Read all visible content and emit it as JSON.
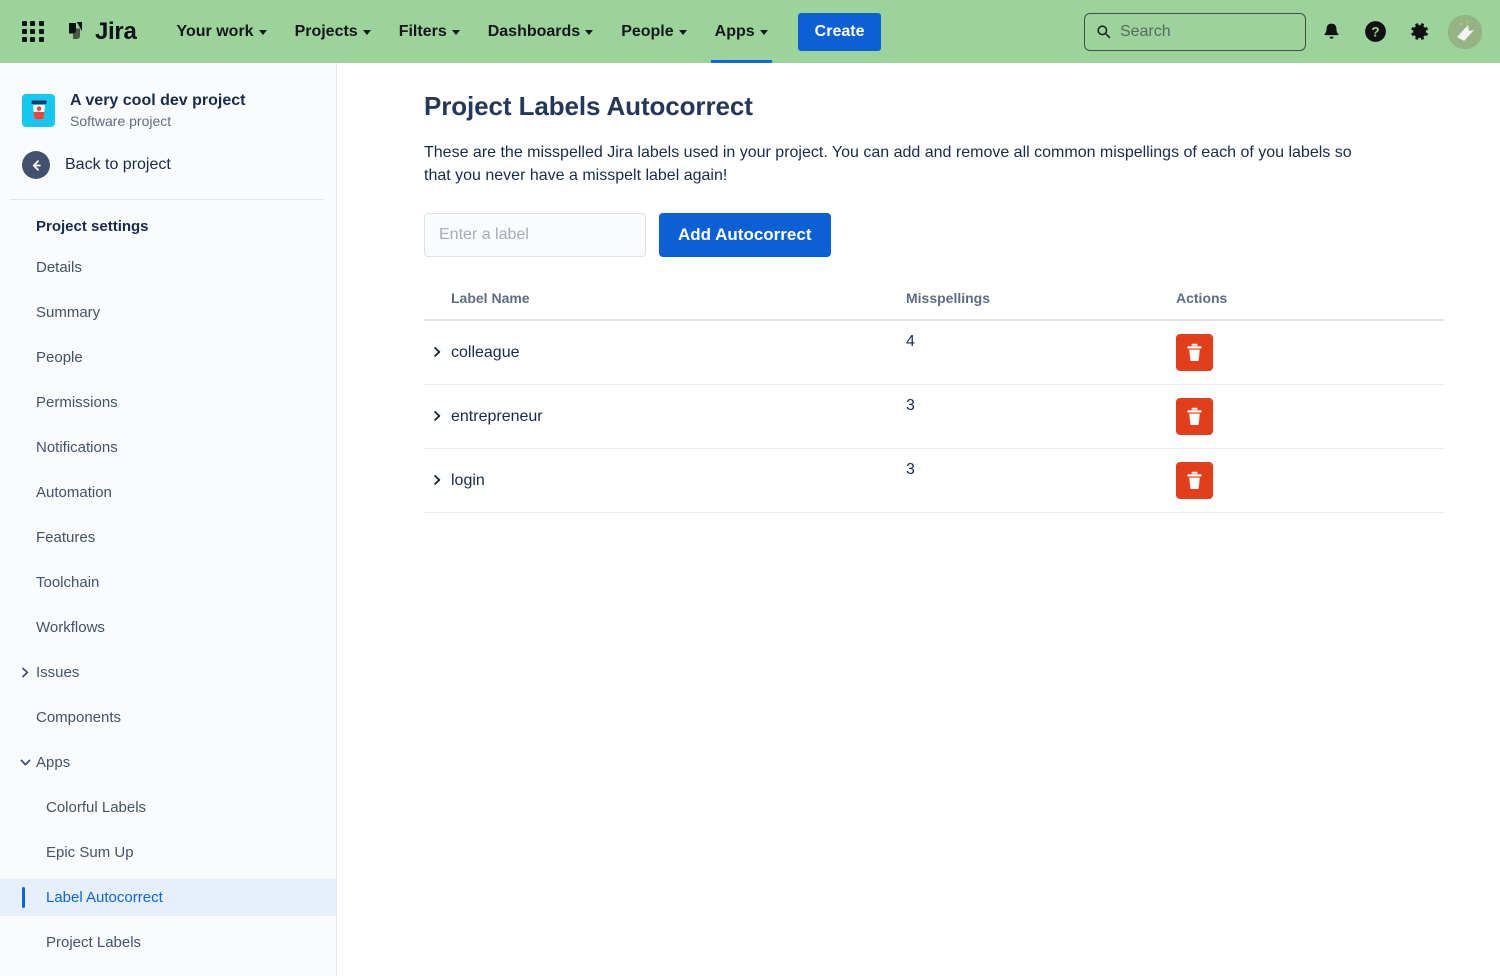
{
  "topnav": {
    "app_switcher": "app-switcher-icon",
    "logo_text": "Jira",
    "items": [
      {
        "label": "Your work",
        "has_caret": true,
        "active": false
      },
      {
        "label": "Projects",
        "has_caret": true,
        "active": false
      },
      {
        "label": "Filters",
        "has_caret": true,
        "active": false
      },
      {
        "label": "Dashboards",
        "has_caret": true,
        "active": false
      },
      {
        "label": "People",
        "has_caret": true,
        "active": false
      },
      {
        "label": "Apps",
        "has_caret": true,
        "active": true
      }
    ],
    "create_label": "Create",
    "search_placeholder": "Search",
    "search_value": "",
    "notifications_icon": "bell-icon",
    "help_icon": "help-icon",
    "settings_icon": "gear-icon",
    "avatar_icon": "user-avatar",
    "background_color": "#9BD39B",
    "accent_color": "#0c5fd4"
  },
  "sidebar": {
    "project_name": "A very cool dev project",
    "project_type": "Software project",
    "project_avatar_icon": "coffee-cup-icon",
    "project_avatar_color": "#16c8f0",
    "back_label": "Back to project",
    "back_icon": "arrow-left-icon",
    "section_title": "Project settings",
    "items": [
      {
        "label": "Details",
        "twisty": "",
        "indent": false,
        "selected": false
      },
      {
        "label": "Summary",
        "twisty": "",
        "indent": false,
        "selected": false
      },
      {
        "label": "People",
        "twisty": "",
        "indent": false,
        "selected": false
      },
      {
        "label": "Permissions",
        "twisty": "",
        "indent": false,
        "selected": false
      },
      {
        "label": "Notifications",
        "twisty": "",
        "indent": false,
        "selected": false
      },
      {
        "label": "Automation",
        "twisty": "",
        "indent": false,
        "selected": false
      },
      {
        "label": "Features",
        "twisty": "",
        "indent": false,
        "selected": false
      },
      {
        "label": "Toolchain",
        "twisty": "",
        "indent": false,
        "selected": false
      },
      {
        "label": "Workflows",
        "twisty": "",
        "indent": false,
        "selected": false
      },
      {
        "label": "Issues",
        "twisty": "right",
        "indent": false,
        "selected": false
      },
      {
        "label": "Components",
        "twisty": "",
        "indent": false,
        "selected": false
      },
      {
        "label": "Apps",
        "twisty": "down",
        "indent": false,
        "selected": false
      },
      {
        "label": "Colorful Labels",
        "twisty": "",
        "indent": true,
        "selected": false
      },
      {
        "label": "Epic Sum Up",
        "twisty": "",
        "indent": true,
        "selected": false
      },
      {
        "label": "Label Autocorrect",
        "twisty": "",
        "indent": true,
        "selected": true
      },
      {
        "label": "Project Labels",
        "twisty": "",
        "indent": true,
        "selected": false
      }
    ],
    "selected_color": "#0c66e4"
  },
  "main": {
    "title": "Project Labels Autocorrect",
    "description": "These are the misspelled Jira labels used in your project. You can add and remove all common mispellings of each of you labels so that you never have a misspelt label again!",
    "input_placeholder": "Enter a label",
    "input_value": "",
    "add_button_label": "Add Autocorrect",
    "table": {
      "headers": [
        "Label Name",
        "Misspellings",
        "Actions"
      ],
      "rows": [
        {
          "name": "colleague",
          "misspellings": "4",
          "delete_icon": "trash-icon"
        },
        {
          "name": "entrepreneur",
          "misspellings": "3",
          "delete_icon": "trash-icon"
        },
        {
          "name": "login",
          "misspellings": "3",
          "delete_icon": "trash-icon"
        }
      ],
      "expand_icon": "chevron-right-icon",
      "delete_button_color": "#e23e1c"
    }
  }
}
